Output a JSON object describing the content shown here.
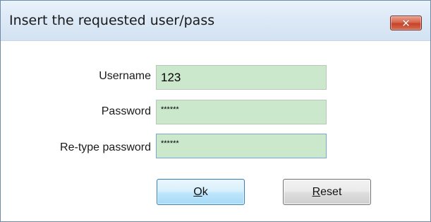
{
  "window": {
    "title": "Insert the requested user/pass",
    "close_icon": "close-icon"
  },
  "form": {
    "username": {
      "label": "Username",
      "value": "123"
    },
    "password": {
      "label": "Password",
      "value": "******"
    },
    "retype_password": {
      "label": "Re-type password",
      "value": "******"
    }
  },
  "buttons": {
    "ok": {
      "mnemonic": "O",
      "rest": "k"
    },
    "reset": {
      "mnemonic": "R",
      "rest": "eset"
    }
  },
  "colors": {
    "field_background": "#cce8cc",
    "close_button": "#c7432a",
    "default_button_border": "#3c7fb1"
  }
}
